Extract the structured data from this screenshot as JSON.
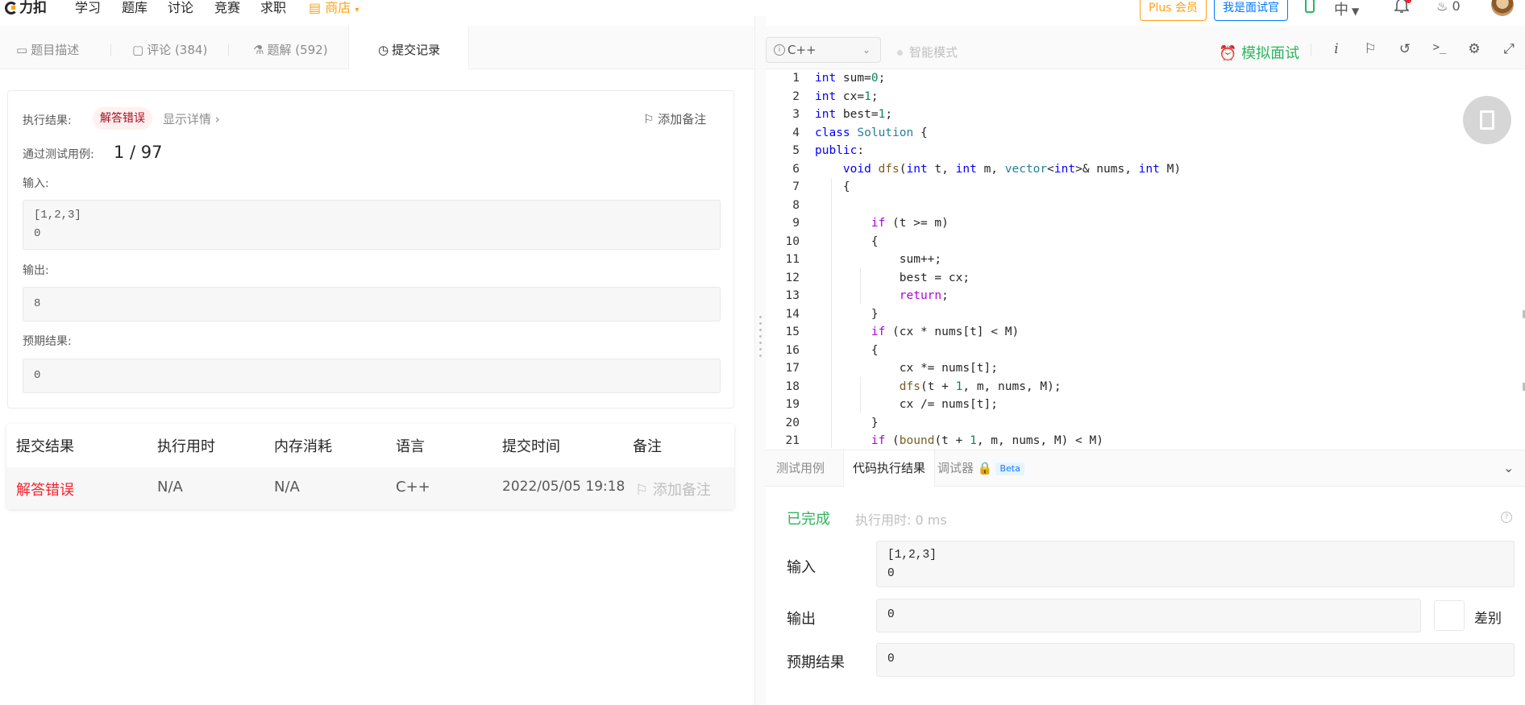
{
  "nav": {
    "logo": "力扣",
    "items": [
      "学习",
      "题库",
      "讨论",
      "竞赛",
      "求职"
    ],
    "shop": "商店",
    "plus_button": "Plus 会员",
    "interviewer_button": "我是面试官",
    "language": "中",
    "streak_count": "0"
  },
  "left_tabs": {
    "description": "题目描述",
    "comments": "评论 (384)",
    "solutions": "题解 (592)",
    "submissions": "提交记录"
  },
  "result": {
    "exec_label": "执行结果:",
    "status": "解答错误",
    "show_details": "显示详情 ›",
    "add_note": "添加备注",
    "passed_label": "通过测试用例:",
    "passed_value": "1 / 97",
    "input_label": "输入:",
    "input_lines": [
      "[1,2,3]",
      "0"
    ],
    "output_label": "输出:",
    "output_value": "8",
    "expected_label": "预期结果:",
    "expected_value": "0"
  },
  "submissions": {
    "headers": [
      "提交结果",
      "执行用时",
      "内存消耗",
      "语言",
      "提交时间",
      "备注"
    ],
    "rows": [
      {
        "result": "解答错误",
        "time": "N/A",
        "memory": "N/A",
        "language": "C++",
        "submitted": "2022/05/05 19:18",
        "note": "添加备注"
      }
    ]
  },
  "editor_toolbar": {
    "language": "C++",
    "smart_mode": "智能模式",
    "mock_interview": "模拟面试"
  },
  "code_lines": [
    "int sum=0;",
    "int cx=1;",
    "int best=1;",
    "class Solution {",
    "public:",
    "    void dfs(int t, int m, vector<int>& nums, int M)",
    "    {",
    "",
    "        if (t >= m)",
    "        {",
    "            sum++;",
    "            best = cx;",
    "            return;",
    "        }",
    "        if (cx * nums[t] < M)",
    "        {",
    "            cx *= nums[t];",
    "            dfs(t + 1, m, nums, M);",
    "            cx /= nums[t];",
    "        }",
    "        if (bound(t + 1, m, nums, M) < M)"
  ],
  "console": {
    "tabs": [
      "测试用例",
      "代码执行结果",
      "调试器"
    ],
    "beta": "Beta",
    "status": "已完成",
    "exec_time": "执行用时: 0 ms",
    "input_label": "输入",
    "input_lines": [
      "[1,2,3]",
      "0"
    ],
    "output_label": "输出",
    "output_value": "0",
    "diff_label": "差别",
    "expected_label": "预期结果",
    "expected_value": "0"
  },
  "colors": {
    "accent": "#ffa116",
    "success": "#2db55d",
    "error": "#f5222d",
    "link": "#007aff"
  }
}
